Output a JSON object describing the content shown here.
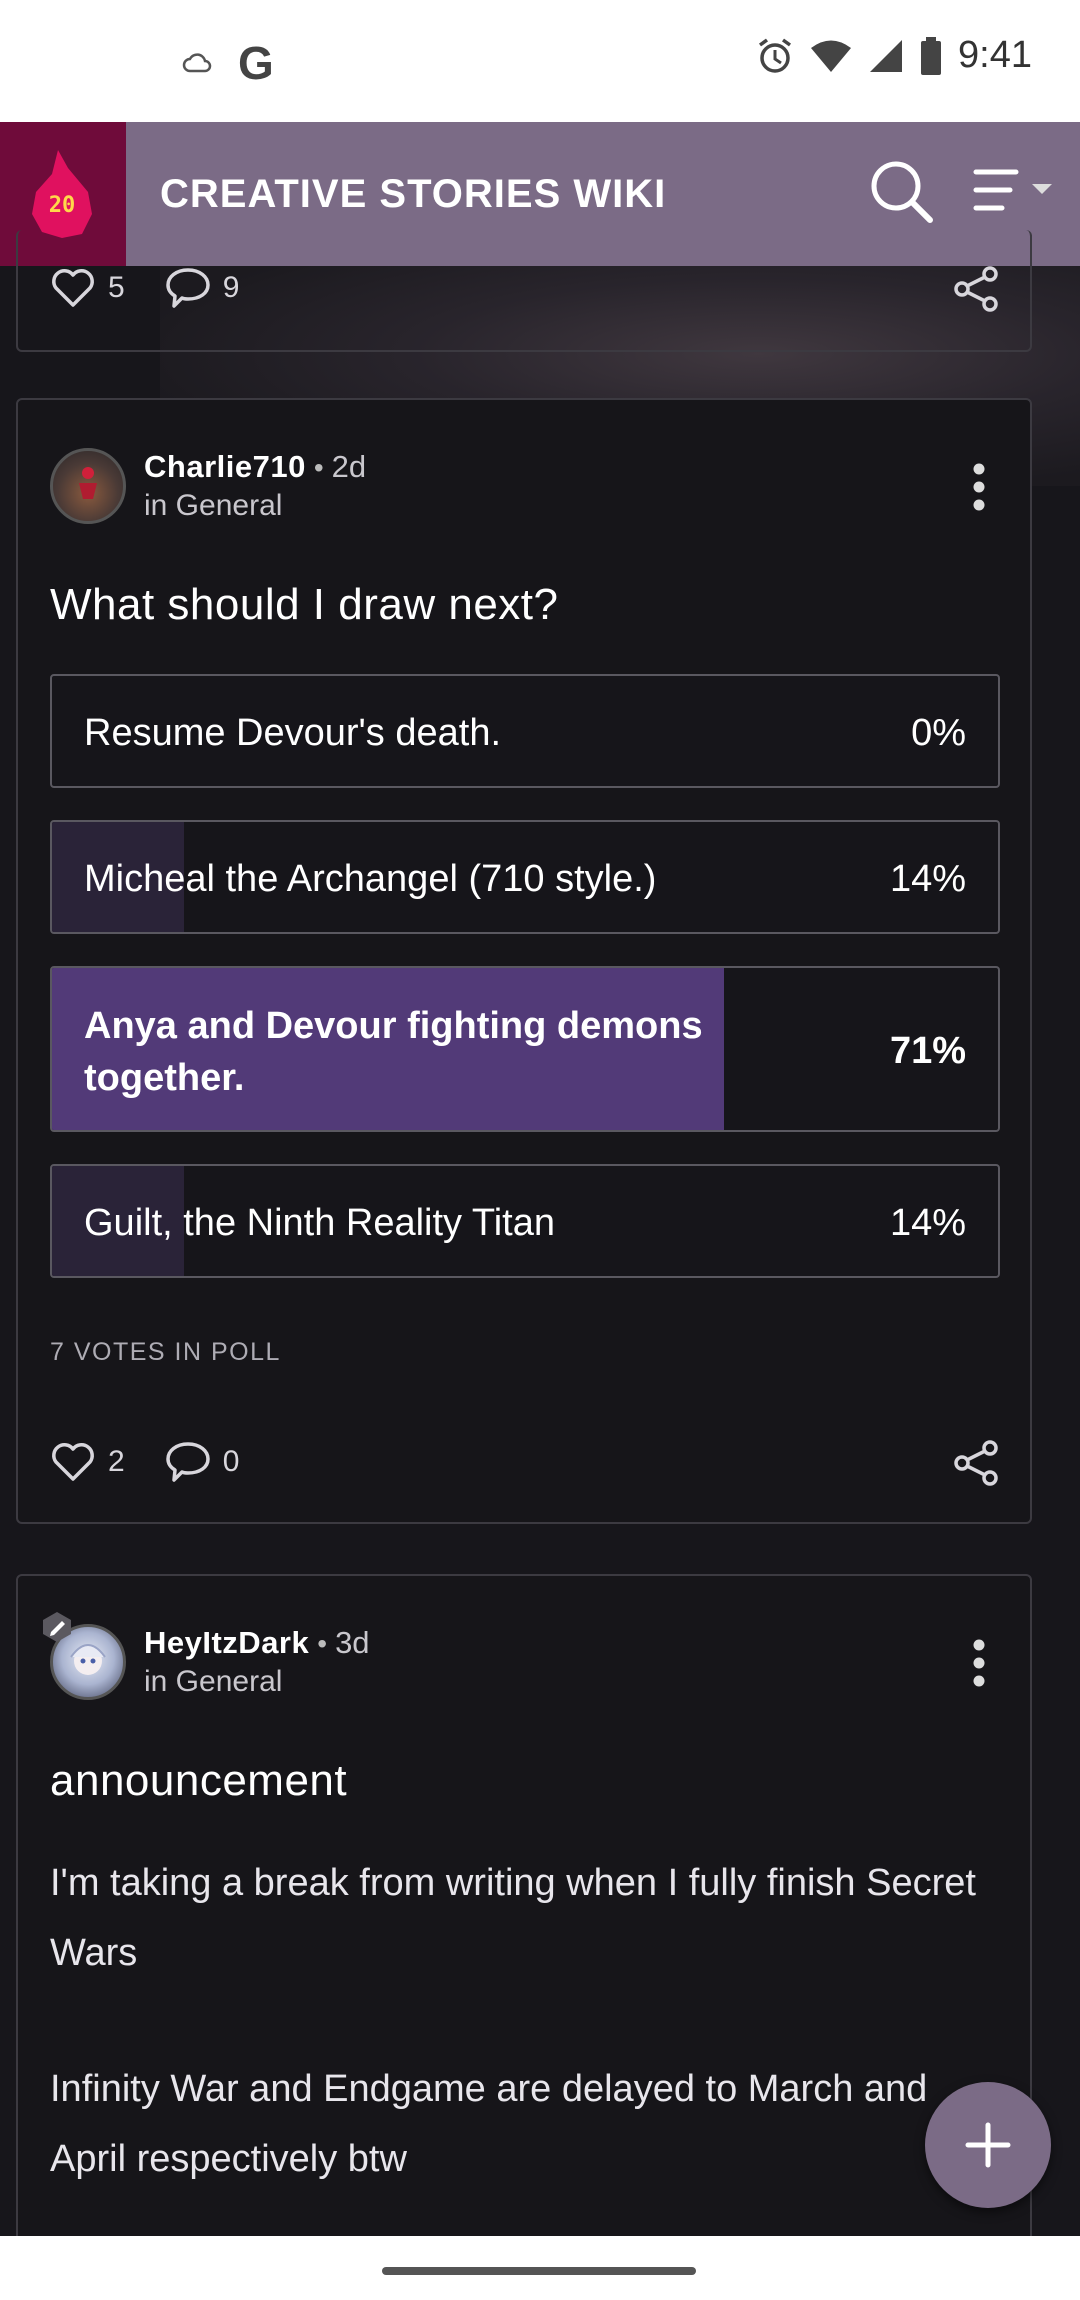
{
  "status_bar": {
    "time": "9:41",
    "left_icons": [
      "cloud-icon",
      "google-icon"
    ],
    "right_icons": [
      "alarm-icon",
      "wifi-icon",
      "signal-icon",
      "battery-icon"
    ],
    "google_letter": "G"
  },
  "header": {
    "logo_badge": "20",
    "title": "CREATIVE STORIES WIKI",
    "colors": {
      "header": "#7b6b86",
      "logo_bg": "#6f0b3a",
      "accent": "#523a78"
    }
  },
  "previous_post": {
    "likes": "5",
    "comments": "9"
  },
  "poll_post": {
    "author": "Charlie710",
    "age": "2d",
    "category": "in General",
    "title": "What should I draw next?",
    "options": [
      {
        "label": "Resume Devour's death.",
        "percent_text": "0%",
        "percent": 0,
        "winner": false
      },
      {
        "label": "Micheal the Archangel (710 style.)",
        "percent_text": "14%",
        "percent": 14,
        "winner": false
      },
      {
        "label": "Anya and Devour fighting demons together.",
        "percent_text": "71%",
        "percent": 71,
        "winner": true
      },
      {
        "label": "Guilt, the Ninth Reality Titan",
        "percent_text": "14%",
        "percent": 14,
        "winner": false
      }
    ],
    "votes_text": "7 VOTES IN POLL",
    "likes": "2",
    "comments": "0"
  },
  "announcement_post": {
    "author": "HeyItzDark",
    "age": "3d",
    "category": "in General",
    "title": "announcement",
    "paragraph_1": "I'm taking a break from writing when I fully finish Secret Wars",
    "paragraph_2": "Infinity War and Endgame are delayed to March and April respectively btw"
  },
  "fab_icon": "plus-icon"
}
